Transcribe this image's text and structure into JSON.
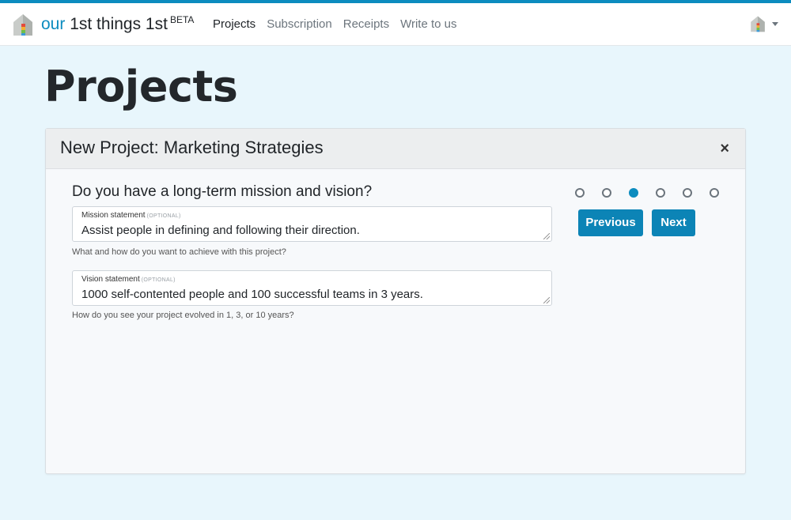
{
  "brand": {
    "our": "our",
    "name": "1st things 1st",
    "badge": "BETA"
  },
  "nav": {
    "items": [
      {
        "label": "Projects"
      },
      {
        "label": "Subscription"
      },
      {
        "label": "Receipts"
      },
      {
        "label": "Write to us"
      }
    ],
    "active": "Projects"
  },
  "page": {
    "title": "Projects"
  },
  "dialog": {
    "title": "New Project: Marketing Strategies",
    "close": "×",
    "question": "Do you have a long-term mission and vision?",
    "fields": [
      {
        "label": "Mission statement",
        "optional": "(OPTIONAL)",
        "value": "Assist people in defining and following their direction.",
        "help": "What and how do you want to achieve with this project?"
      },
      {
        "label": "Vision statement",
        "optional": "(OPTIONAL)",
        "value": "1000 self-contented people and 100 successful teams in 3 years.",
        "help": "How do you see your project evolved in 1, 3, or 10 years?"
      }
    ],
    "steps": {
      "total": 6,
      "current": 3
    },
    "previous": "Previous",
    "next": "Next"
  },
  "colors": {
    "accent": "#0c8cbf",
    "background": "#e8f6fc"
  }
}
